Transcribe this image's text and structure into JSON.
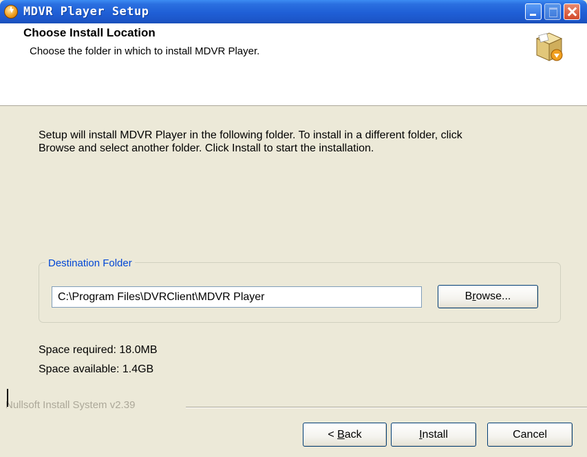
{
  "window": {
    "title": "MDVR Player Setup"
  },
  "header": {
    "title": "Choose Install Location",
    "subtitle": "Choose the folder in which to install MDVR Player."
  },
  "body": {
    "description_line1": "Setup will install MDVR Player in the following folder. To install in a different folder, click",
    "description_line2": "Browse and select another folder. Click Install to start the installation."
  },
  "destination": {
    "legend": "Destination Folder",
    "path": "C:\\Program Files\\DVRClient\\MDVR Player",
    "browse_label_prefix": "B",
    "browse_label_accel": "r",
    "browse_label_suffix": "owse..."
  },
  "space": {
    "required": "Space required: 18.0MB",
    "available": "Space available: 1.4GB"
  },
  "footer": {
    "branding": "Nullsoft Install System v2.39",
    "back_prefix": "< ",
    "back_accel": "B",
    "back_suffix": "ack",
    "install_accel": "I",
    "install_suffix": "nstall",
    "cancel_label": "Cancel"
  },
  "colors": {
    "titlebar": "#1f5fd6",
    "dialog_bg": "#ece9d8",
    "legend_text": "#0046d5",
    "close_button": "#d2492a"
  },
  "icons": [
    "installer-app-icon",
    "minimize-icon",
    "maximize-icon",
    "close-icon",
    "installer-box-icon"
  ]
}
